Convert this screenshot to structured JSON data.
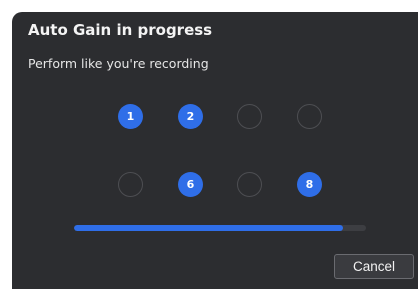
{
  "dialog": {
    "title": "Auto Gain in progress",
    "subtitle": "Perform like you're recording"
  },
  "channels": [
    {
      "label": "1",
      "active": true
    },
    {
      "label": "2",
      "active": true
    },
    {
      "label": "",
      "active": false
    },
    {
      "label": "",
      "active": false
    },
    {
      "label": "",
      "active": false
    },
    {
      "label": "6",
      "active": true
    },
    {
      "label": "",
      "active": false
    },
    {
      "label": "8",
      "active": true
    }
  ],
  "progress": {
    "fraction": 0.92
  },
  "buttons": {
    "cancel_label": "Cancel"
  },
  "colors": {
    "background": "#2c2d30",
    "accent": "#2f6ee8",
    "track": "#3d3e42",
    "inactive_ring": "#4d4e52"
  }
}
